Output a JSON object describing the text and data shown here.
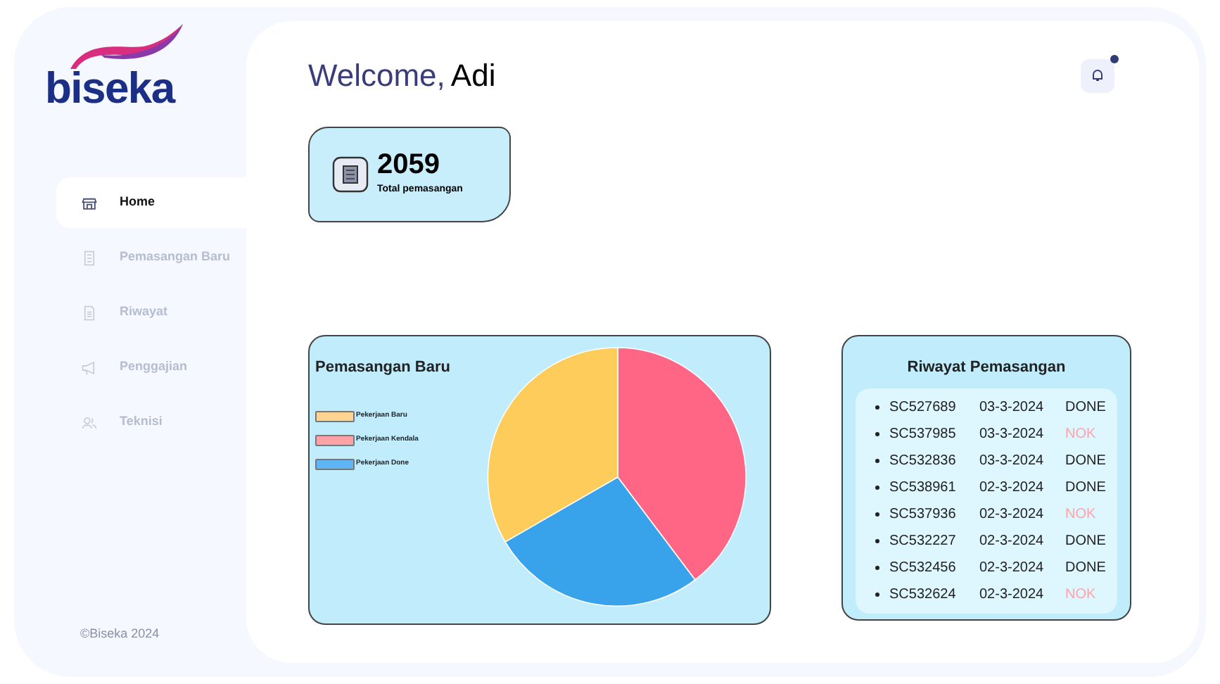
{
  "brand": {
    "name": "biseka"
  },
  "sidebar": {
    "items": [
      {
        "label": "Home",
        "selected": true
      },
      {
        "label": "Pemasangan Baru",
        "selected": false
      },
      {
        "label": "Riwayat",
        "selected": false
      },
      {
        "label": "Penggajian",
        "selected": false
      },
      {
        "label": "Teknisi",
        "selected": false
      }
    ],
    "footer": "©Biseka 2024"
  },
  "header": {
    "greeting": "Welcome,",
    "user": "Adi",
    "notifications": {
      "unread": true
    }
  },
  "stat": {
    "value": "2059",
    "label": "Total pemasangan"
  },
  "pie_card": {
    "title": "Pemasangan Baru",
    "legend": [
      {
        "label": "Pekerjaan Baru",
        "color": "#ffd391"
      },
      {
        "label": "Pekerjaan Kendala",
        "color": "#ffa3a8"
      },
      {
        "label": "Pekerjaan Done",
        "color": "#5eb5f5"
      }
    ]
  },
  "history": {
    "title": "Riwayat Pemasangan",
    "rows": [
      {
        "code": "SC527689",
        "date": "03-3-2024",
        "status": "DONE",
        "flagged": false
      },
      {
        "code": "SC537985",
        "date": "03-3-2024",
        "status": "NOK",
        "flagged": true
      },
      {
        "code": "SC532836",
        "date": "03-3-2024",
        "status": "DONE",
        "flagged": false
      },
      {
        "code": "SC538961",
        "date": "02-3-2024",
        "status": "DONE",
        "flagged": false
      },
      {
        "code": "SC537936",
        "date": "02-3-2024",
        "status": "NOK",
        "flagged": true
      },
      {
        "code": "SC532227",
        "date": "02-3-2024",
        "status": "DONE",
        "flagged": false
      },
      {
        "code": "SC532456",
        "date": "02-3-2024",
        "status": "DONE",
        "flagged": false
      },
      {
        "code": "SC532624",
        "date": "02-3-2024",
        "status": "NOK",
        "flagged": true
      }
    ]
  }
}
